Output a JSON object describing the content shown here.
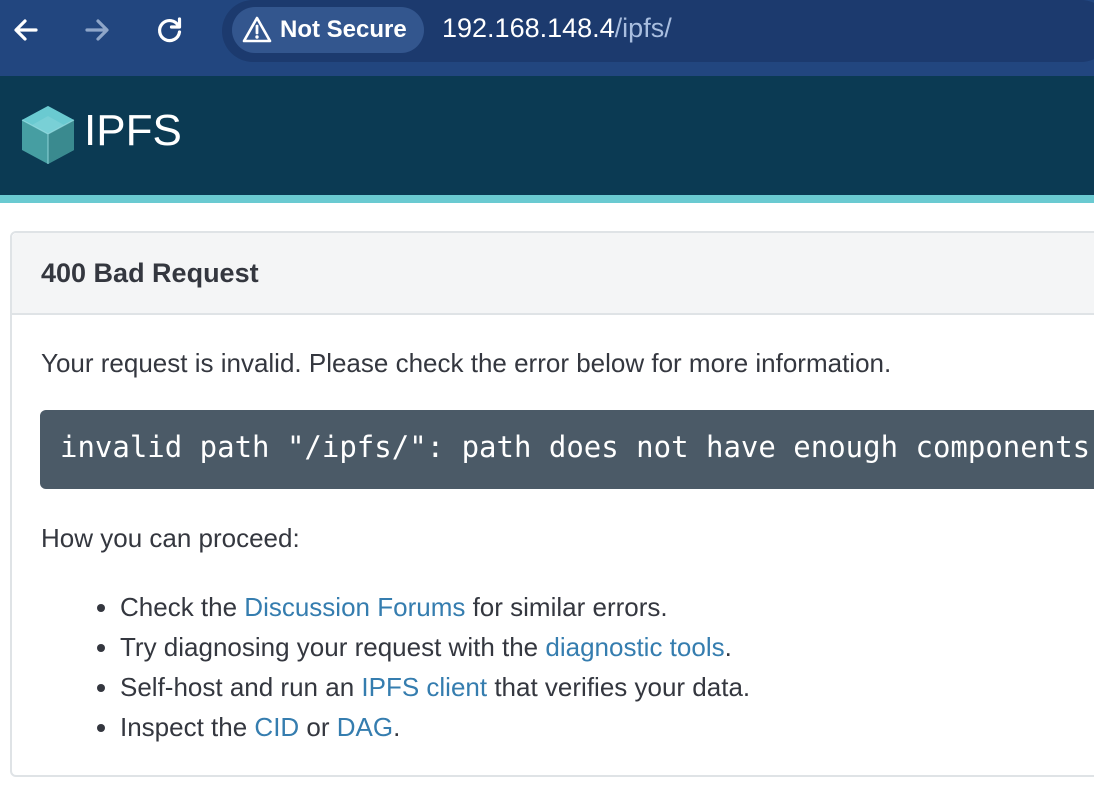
{
  "browser": {
    "security_label": "Not Secure",
    "url_host": "192.168.148.4",
    "url_path": "/ipfs/"
  },
  "header": {
    "brand": "IPFS"
  },
  "error": {
    "title": "400 Bad Request",
    "intro": "Your request is invalid. Please check the error below for more information.",
    "message": "invalid path \"/ipfs/\": path does not have enough components",
    "proceed_heading": "How you can proceed:",
    "steps": [
      {
        "before": "Check the ",
        "link": "Discussion Forums",
        "after": " for similar errors."
      },
      {
        "before": "Try diagnosing your request with the ",
        "link": "diagnostic tools",
        "after": "."
      },
      {
        "before": "Self-host and run an ",
        "link": "IPFS client",
        "after": " that verifies your data."
      },
      {
        "before": "Inspect the ",
        "link": "CID",
        "middle": " or ",
        "link2": "DAG",
        "after": "."
      }
    ]
  },
  "colors": {
    "browser_bar": "#22467f",
    "header_bg": "#0b3a53",
    "header_stripe": "#6acad1",
    "link": "#357daf",
    "error_box": "#4b5a67"
  }
}
